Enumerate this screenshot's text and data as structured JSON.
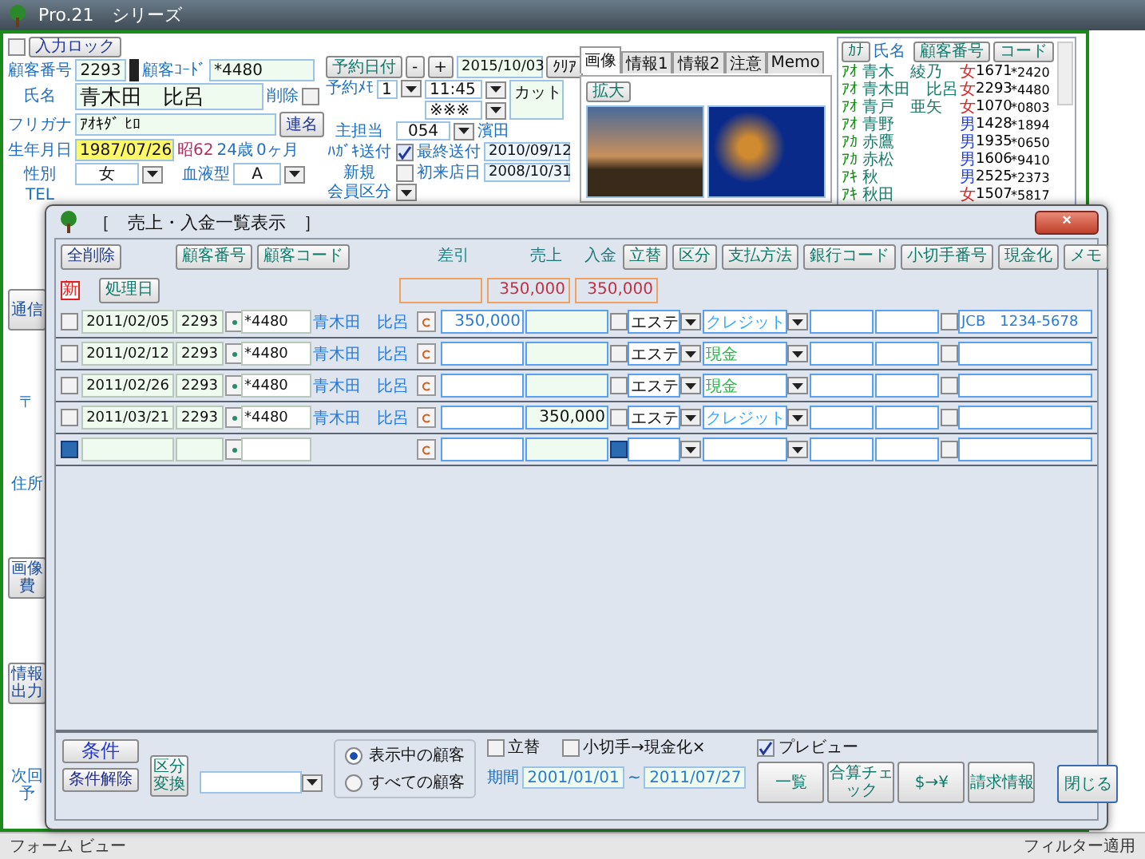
{
  "app_title": "Pro.21　シリーズ",
  "input_lock": {
    "label": "入力ロック",
    "checked": false
  },
  "customer": {
    "no_label": "顧客番号",
    "no": "2293",
    "code_label": "顧客ｺｰﾄﾞ",
    "code": "*4480",
    "name_label": "氏名",
    "name": "青木田　比呂",
    "delete_label": "削除",
    "delete_checked": false,
    "furigana_label": "フリガナ",
    "furigana": "ｱｵｷﾀﾞ ﾋﾛ",
    "joint_button": "連名",
    "birth_label": "生年月日",
    "birth": "1987/07/26",
    "era": "昭62",
    "age": "24歳",
    "months": "0ヶ月",
    "gender_label": "性別",
    "gender": "女",
    "blood_label": "血液型",
    "blood": "A",
    "tel_label": "TEL"
  },
  "reservation": {
    "date_button": "予約日付",
    "minus": "-",
    "plus": "+",
    "date": "2015/10/03",
    "clear": "ｸﾘｱ",
    "memo_label": "予約ﾒﾓ",
    "memo_no": "1",
    "time": "11:45",
    "marks": "※※※",
    "menu": "カット",
    "staff_label": "主担当",
    "staff_code": "054",
    "staff_name": "濱田",
    "postcard_label": "ﾊｶﾞｷ送付",
    "postcard_checked": true,
    "last_sent_label": "最終送付",
    "last_sent": "2010/09/12",
    "new_label": "新規",
    "new_checked": false,
    "first_visit_label": "初来店日",
    "first_visit": "2008/10/31",
    "member_label": "会員区分"
  },
  "side_items": [
    {
      "kind": "button",
      "label": "通信"
    },
    {
      "kind": "label",
      "label": "〒"
    },
    {
      "kind": "label",
      "label": "住所"
    },
    {
      "kind": "button",
      "label": "画像費"
    },
    {
      "kind": "button",
      "label": "情報出力"
    },
    {
      "kind": "label",
      "label": "次回予"
    }
  ],
  "tabs": [
    {
      "label": "画像",
      "selected": true
    },
    {
      "label": "情報1",
      "selected": false
    },
    {
      "label": "情報2",
      "selected": false
    },
    {
      "label": "注意",
      "selected": false
    },
    {
      "label": "Memo",
      "selected": false
    }
  ],
  "zoom_button": "拡大",
  "customer_list": {
    "headers": [
      "ｶﾅ",
      "氏名",
      "顧客番号",
      "コード"
    ],
    "rows": [
      {
        "kana": "ｱｵ",
        "name": "青木　綾乃",
        "gender": "女",
        "color": "#e02020",
        "no": "1671",
        "code": "*2420"
      },
      {
        "kana": "ｱｵ",
        "name": "青木田　比呂",
        "gender": "女",
        "color": "#e02020",
        "no": "2293",
        "code": "*4480"
      },
      {
        "kana": "ｱｵ",
        "name": "青戸　亜矢",
        "gender": "女",
        "color": "#e02020",
        "no": "1070",
        "code": "*0803"
      },
      {
        "kana": "ｱｵ",
        "name": "青野",
        "gender": "男",
        "color": "#2040e0",
        "no": "1428",
        "code": "*1894"
      },
      {
        "kana": "ｱｶ",
        "name": "赤鷹",
        "gender": "男",
        "color": "#2040e0",
        "no": "1935",
        "code": "*0650"
      },
      {
        "kana": "ｱｶ",
        "name": "赤松",
        "gender": "男",
        "color": "#2040e0",
        "no": "1606",
        "code": "*9410"
      },
      {
        "kana": "ｱｷ",
        "name": "秋",
        "gender": "男",
        "color": "#2040e0",
        "no": "2525",
        "code": "*2373"
      },
      {
        "kana": "ｱｷ",
        "name": "秋田",
        "gender": "女",
        "color": "#e02020",
        "no": "1507",
        "code": "*5817"
      }
    ]
  },
  "dialog": {
    "title": "［　売上・入金一覧表示　］",
    "close": "×",
    "buttons": {
      "delete_all": "全削除",
      "date": "処理日",
      "customer_no": "顧客番号",
      "customer_code": "顧客コード",
      "advance": "立替",
      "category": "区分",
      "payment_method": "支払方法",
      "bank_code": "銀行コード",
      "check_no": "小切手番号",
      "cashed": "現金化",
      "memo": "メモ"
    },
    "new_mark": "新",
    "labels": {
      "discount": "差引",
      "sales": "売上",
      "payment": "入金"
    },
    "totals": {
      "sales": "350,000",
      "payment": "350,000"
    },
    "rows": [
      {
        "kind": "entry",
        "checked": false,
        "date": "2011/02/05",
        "no": "2293",
        "code": "*4480",
        "name": "青木田　比呂",
        "sales": "350,000",
        "payment": "",
        "advance": false,
        "category": "エステ",
        "method": "クレジット",
        "color": "#33aaff",
        "cashed": false,
        "memo": "JCB　1234-5678"
      },
      {
        "kind": "entry",
        "checked": false,
        "date": "2011/02/12",
        "no": "2293",
        "code": "*4480",
        "name": "青木田　比呂",
        "sales": "",
        "payment": "",
        "advance": false,
        "category": "エステ",
        "method": "現金",
        "color": "#22bb44",
        "cashed": false,
        "memo": ""
      },
      {
        "kind": "entry",
        "checked": false,
        "date": "2011/02/26",
        "no": "2293",
        "code": "*4480",
        "name": "青木田　比呂",
        "sales": "",
        "payment": "",
        "advance": false,
        "category": "エステ",
        "method": "現金",
        "color": "#22bb44",
        "cashed": false,
        "memo": ""
      },
      {
        "kind": "entry",
        "checked": false,
        "date": "2011/03/21",
        "no": "2293",
        "code": "*4480",
        "name": "青木田　比呂",
        "sales": "",
        "payment": "350,000",
        "advance": false,
        "category": "エステ",
        "method": "クレジット",
        "color": "#33aaff",
        "cashed": false,
        "memo": ""
      },
      {
        "kind": "new",
        "cashed": false
      }
    ],
    "footer": {
      "condition": "条件",
      "clear_condition": "条件解除",
      "convert": "区分変換",
      "scope": [
        {
          "label": "表示中の顧客",
          "selected": true
        },
        {
          "label": "すべての顧客",
          "selected": false
        }
      ],
      "advance_label": "立替",
      "advance_checked": false,
      "check_label": "小切手→現金化×",
      "check_checked": false,
      "period_label": "期間",
      "from": "2001/01/01",
      "tilde": "~",
      "to": "2011/07/27",
      "preview_label": "プレビュー",
      "preview_checked": true,
      "actions": [
        "一覧",
        "合算チェック",
        "$→¥",
        "請求情報"
      ],
      "close": "閉じる"
    }
  },
  "status_bar": {
    "left": "フォーム ビュー",
    "right": "フィルター適用"
  }
}
